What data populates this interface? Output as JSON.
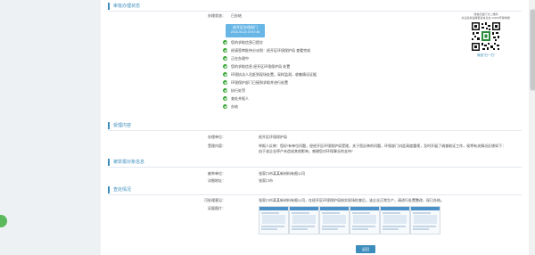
{
  "sections": {
    "status": {
      "title": "审批办理状态",
      "status_label": "办理状态：",
      "status_value": "已办结",
      "stage_title": "经开区办理部门",
      "stage_time": "2018-03-23 19:47:46",
      "steps": [
        "您的求助信息已提交",
        "经请签审批待分派到：经开区环境保护局 查看完成",
        "正在办理中",
        "您的求助信息 经开区环境保护局 处置",
        "环境执法人员赶到现场处置，采样监测，收集情况证据",
        "环境保护部门已接到求助并进行处置",
        "执行处罚",
        "查处并报人",
        "办结"
      ],
      "qr_caption_1": "微信扫描下方二维码",
      "qr_caption_2": "关注最新进展更多信息在“12369环保举报”",
      "qr_link": "微信“扫一扫”"
    },
    "complaint": {
      "title": "受理内容",
      "dept_label": "办理单位：",
      "dept_value": "经开区环境保护局",
      "content_label": "受理内容：",
      "content_value": "举报人反映：您好!有单位问题，经经开区环境保护局受理，关于您反映的问题，环保部门对此高度重视，及时开展了调查取证工作，现将有关情况反馈如下：由于该企业停产未造成其他影响，感谢您对环保事业的支持！"
    },
    "petitioner": {
      "title": "被举报对象信息",
      "name_label": "被举单位：",
      "name_value": "张家口市某某新材料有限公司",
      "addr_label": "详细地址：",
      "addr_value": "张家口市"
    },
    "result": {
      "title": "查处情况",
      "process_label": "可处理意见：",
      "process_value": "张家口市某某新材料有限公司，在经开区环境保护局核实现场检查后，该企业正常生产，请进行处置整改，现已办结。",
      "evidence_label": "证据图片："
    }
  },
  "back_button": "返回",
  "colors": {
    "accent": "#3c8dbc",
    "check": "#35a435",
    "stage_badge": "#68b6e6"
  }
}
